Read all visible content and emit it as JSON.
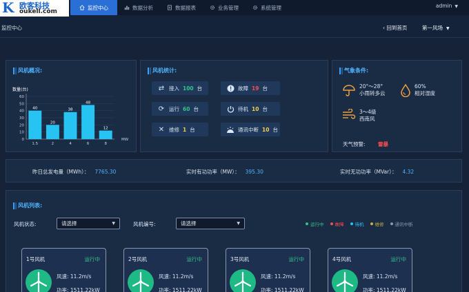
{
  "brand": {
    "name_cn": "欧客科技",
    "name_en": "oukell.com"
  },
  "nav": [
    {
      "label": "监控中心",
      "icon": "home-icon",
      "active": true
    },
    {
      "label": "数据分析",
      "icon": "bar-chart-icon"
    },
    {
      "label": "数据报表",
      "icon": "file-icon"
    },
    {
      "label": "业务管理",
      "icon": "gear-icon"
    },
    {
      "label": "系统管理",
      "icon": "gear-icon"
    }
  ],
  "user": "admin",
  "breadcrumb": "监控中心",
  "back_label": "回到首页",
  "farm_select": "第一风场",
  "overview": {
    "title": "风机概况:",
    "chart_data": {
      "type": "bar",
      "ylabel": "数量(台)",
      "xlabel": "MW",
      "categories": [
        "1.5",
        "2",
        "4",
        "6",
        "8"
      ],
      "values": [
        40,
        20,
        38,
        48,
        12
      ],
      "ylim": [
        0,
        60
      ],
      "yticks": [
        "0",
        "10",
        "20",
        "30",
        "40",
        "50",
        "60"
      ],
      "bar_color": "#27c3f3"
    }
  },
  "stats": {
    "title": "风机统计:",
    "items": [
      {
        "label": "接入",
        "value": "100",
        "unit": "台",
        "color": "#34c48b",
        "icon": "link-icon"
      },
      {
        "label": "故障",
        "value": "19",
        "unit": "台",
        "color": "#ff4d4f",
        "icon": "alert-icon"
      },
      {
        "label": "运行",
        "value": "60",
        "unit": "台",
        "color": "#34c48b",
        "icon": "refresh-icon"
      },
      {
        "label": "待机",
        "value": "10",
        "unit": "台",
        "color": "#f5d04c",
        "icon": "power-icon"
      },
      {
        "label": "维修",
        "value": "1",
        "unit": "台",
        "color": "#f5d04c",
        "icon": "tools-icon"
      },
      {
        "label": "通讯中断",
        "value": "10",
        "unit": "台",
        "color": "#f5d04c",
        "icon": "signal-icon"
      }
    ]
  },
  "weather": {
    "title": "气象条件:",
    "temp": "20°～28°",
    "desc": "小雨转多云",
    "humidity": "60%",
    "humidity_label": "相对湿度",
    "wind_level": "3～4级",
    "wind_dir": "西南风",
    "alert_label": "天气预警:",
    "alert_value": "雷暴"
  },
  "summary": [
    {
      "label": "昨日总发电量（MWh）：",
      "value": "7765.30"
    },
    {
      "label": "实时有功功率（MW）：",
      "value": "395.30"
    },
    {
      "label": "实时无功功率（MVar）：",
      "value": "4.32"
    }
  ],
  "list": {
    "title": "风机列表:",
    "status_label": "风机状态:",
    "status_value": "请选择",
    "id_label": "风机编号:",
    "id_value": "请选择",
    "legend": [
      {
        "label": "运行中",
        "color": "#34c48b"
      },
      {
        "label": "故障",
        "color": "#ff4d4f"
      },
      {
        "label": "待机",
        "color": "#27c3f3"
      },
      {
        "label": "维修",
        "color": "#c9b040"
      },
      {
        "label": "通讯中断",
        "color": "#8a97ab"
      }
    ],
    "cards": [
      {
        "name": "1号风机",
        "status": "运行中",
        "speed": "风速:  11.2m/s",
        "power": "功率:  1511.22kW"
      },
      {
        "name": "2号风机",
        "status": "运行中",
        "speed": "风速:  11.2m/s",
        "power": "功率:  1511.22kW"
      },
      {
        "name": "3号风机",
        "status": "运行中",
        "speed": "风速:  11.2m/s",
        "power": "功率:  1511.22kW"
      },
      {
        "name": "4号风机",
        "status": "运行中",
        "speed": "风速:  11.2m/s",
        "power": "功率:  1511.22kW"
      }
    ]
  }
}
